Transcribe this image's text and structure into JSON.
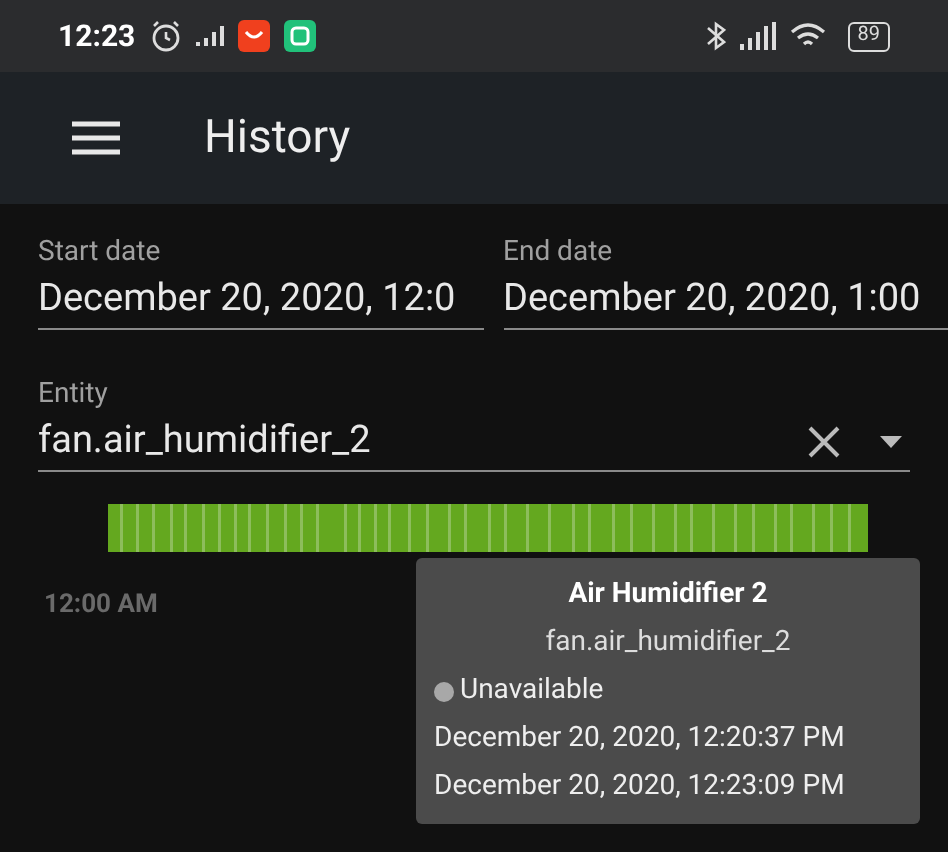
{
  "status_bar": {
    "time": "12:23",
    "battery": "89"
  },
  "app_bar": {
    "title": "History"
  },
  "start_date": {
    "label": "Start date",
    "value": "December 20, 2020, 12:0"
  },
  "end_date": {
    "label": "End date",
    "value": "December 20, 2020, 1:00"
  },
  "entity": {
    "label": "Entity",
    "value": "fan.air_humidifier_2"
  },
  "timeline": {
    "axis_labels": [
      "12:00 AM"
    ]
  },
  "tooltip": {
    "title": "Air Humidifier 2",
    "entity_id": "fan.air_humidifier_2",
    "state": "Unavailable",
    "color": "#a8a8a8",
    "start": "December 20, 2020, 12:20:37 PM",
    "end": "December 20, 2020, 12:23:09 PM"
  }
}
